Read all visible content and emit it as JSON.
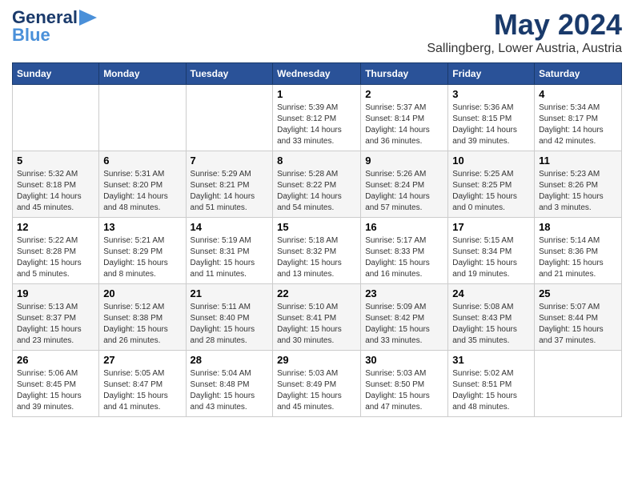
{
  "header": {
    "logo_line1": "General",
    "logo_line2": "Blue",
    "month_year": "May 2024",
    "location": "Sallingberg, Lower Austria, Austria"
  },
  "weekdays": [
    "Sunday",
    "Monday",
    "Tuesday",
    "Wednesday",
    "Thursday",
    "Friday",
    "Saturday"
  ],
  "weeks": [
    [
      {
        "day": "",
        "info": ""
      },
      {
        "day": "",
        "info": ""
      },
      {
        "day": "",
        "info": ""
      },
      {
        "day": "1",
        "info": "Sunrise: 5:39 AM\nSunset: 8:12 PM\nDaylight: 14 hours\nand 33 minutes."
      },
      {
        "day": "2",
        "info": "Sunrise: 5:37 AM\nSunset: 8:14 PM\nDaylight: 14 hours\nand 36 minutes."
      },
      {
        "day": "3",
        "info": "Sunrise: 5:36 AM\nSunset: 8:15 PM\nDaylight: 14 hours\nand 39 minutes."
      },
      {
        "day": "4",
        "info": "Sunrise: 5:34 AM\nSunset: 8:17 PM\nDaylight: 14 hours\nand 42 minutes."
      }
    ],
    [
      {
        "day": "5",
        "info": "Sunrise: 5:32 AM\nSunset: 8:18 PM\nDaylight: 14 hours\nand 45 minutes."
      },
      {
        "day": "6",
        "info": "Sunrise: 5:31 AM\nSunset: 8:20 PM\nDaylight: 14 hours\nand 48 minutes."
      },
      {
        "day": "7",
        "info": "Sunrise: 5:29 AM\nSunset: 8:21 PM\nDaylight: 14 hours\nand 51 minutes."
      },
      {
        "day": "8",
        "info": "Sunrise: 5:28 AM\nSunset: 8:22 PM\nDaylight: 14 hours\nand 54 minutes."
      },
      {
        "day": "9",
        "info": "Sunrise: 5:26 AM\nSunset: 8:24 PM\nDaylight: 14 hours\nand 57 minutes."
      },
      {
        "day": "10",
        "info": "Sunrise: 5:25 AM\nSunset: 8:25 PM\nDaylight: 15 hours\nand 0 minutes."
      },
      {
        "day": "11",
        "info": "Sunrise: 5:23 AM\nSunset: 8:26 PM\nDaylight: 15 hours\nand 3 minutes."
      }
    ],
    [
      {
        "day": "12",
        "info": "Sunrise: 5:22 AM\nSunset: 8:28 PM\nDaylight: 15 hours\nand 5 minutes."
      },
      {
        "day": "13",
        "info": "Sunrise: 5:21 AM\nSunset: 8:29 PM\nDaylight: 15 hours\nand 8 minutes."
      },
      {
        "day": "14",
        "info": "Sunrise: 5:19 AM\nSunset: 8:31 PM\nDaylight: 15 hours\nand 11 minutes."
      },
      {
        "day": "15",
        "info": "Sunrise: 5:18 AM\nSunset: 8:32 PM\nDaylight: 15 hours\nand 13 minutes."
      },
      {
        "day": "16",
        "info": "Sunrise: 5:17 AM\nSunset: 8:33 PM\nDaylight: 15 hours\nand 16 minutes."
      },
      {
        "day": "17",
        "info": "Sunrise: 5:15 AM\nSunset: 8:34 PM\nDaylight: 15 hours\nand 19 minutes."
      },
      {
        "day": "18",
        "info": "Sunrise: 5:14 AM\nSunset: 8:36 PM\nDaylight: 15 hours\nand 21 minutes."
      }
    ],
    [
      {
        "day": "19",
        "info": "Sunrise: 5:13 AM\nSunset: 8:37 PM\nDaylight: 15 hours\nand 23 minutes."
      },
      {
        "day": "20",
        "info": "Sunrise: 5:12 AM\nSunset: 8:38 PM\nDaylight: 15 hours\nand 26 minutes."
      },
      {
        "day": "21",
        "info": "Sunrise: 5:11 AM\nSunset: 8:40 PM\nDaylight: 15 hours\nand 28 minutes."
      },
      {
        "day": "22",
        "info": "Sunrise: 5:10 AM\nSunset: 8:41 PM\nDaylight: 15 hours\nand 30 minutes."
      },
      {
        "day": "23",
        "info": "Sunrise: 5:09 AM\nSunset: 8:42 PM\nDaylight: 15 hours\nand 33 minutes."
      },
      {
        "day": "24",
        "info": "Sunrise: 5:08 AM\nSunset: 8:43 PM\nDaylight: 15 hours\nand 35 minutes."
      },
      {
        "day": "25",
        "info": "Sunrise: 5:07 AM\nSunset: 8:44 PM\nDaylight: 15 hours\nand 37 minutes."
      }
    ],
    [
      {
        "day": "26",
        "info": "Sunrise: 5:06 AM\nSunset: 8:45 PM\nDaylight: 15 hours\nand 39 minutes."
      },
      {
        "day": "27",
        "info": "Sunrise: 5:05 AM\nSunset: 8:47 PM\nDaylight: 15 hours\nand 41 minutes."
      },
      {
        "day": "28",
        "info": "Sunrise: 5:04 AM\nSunset: 8:48 PM\nDaylight: 15 hours\nand 43 minutes."
      },
      {
        "day": "29",
        "info": "Sunrise: 5:03 AM\nSunset: 8:49 PM\nDaylight: 15 hours\nand 45 minutes."
      },
      {
        "day": "30",
        "info": "Sunrise: 5:03 AM\nSunset: 8:50 PM\nDaylight: 15 hours\nand 47 minutes."
      },
      {
        "day": "31",
        "info": "Sunrise: 5:02 AM\nSunset: 8:51 PM\nDaylight: 15 hours\nand 48 minutes."
      },
      {
        "day": "",
        "info": ""
      }
    ]
  ]
}
